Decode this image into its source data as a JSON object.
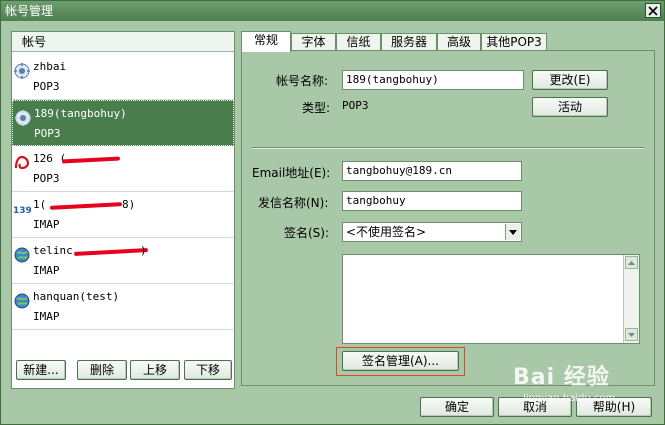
{
  "window": {
    "title": "帐号管理"
  },
  "accounts": {
    "header": "帐号",
    "items": [
      {
        "name": "zhbai",
        "type": "POP3",
        "icon": "gear-globe-icon"
      },
      {
        "name": "189(tangbohuy)",
        "type": "POP3",
        "icon": "gear-globe-icon"
      },
      {
        "name": "126 (",
        "type": "POP3",
        "icon": "mail-126-icon"
      },
      {
        "name": "1(",
        "type": "IMAP",
        "icon": "mail-139-icon",
        "name_suffix": "8)"
      },
      {
        "name": "telinc",
        "type": "IMAP",
        "icon": "globe-icon",
        "name_suffix": ")"
      },
      {
        "name": "hanquan(test)",
        "type": "IMAP",
        "icon": "globe-icon"
      }
    ],
    "buttons": {
      "new": "新建...",
      "delete": "删除",
      "up": "上移",
      "down": "下移"
    }
  },
  "tabs": [
    "常规",
    "字体",
    "信纸",
    "服务器",
    "高级",
    "其他POP3"
  ],
  "general": {
    "account_name_label": "帐号名称:",
    "account_name_value": "189(tangbohuy)",
    "change_button": "更改(E)",
    "type_label": "类型:",
    "type_value": "POP3",
    "active_button": "活动",
    "email_label": "Email地址(E):",
    "email_value": "tangbohuy@189.cn",
    "sender_label": "发信名称(N):",
    "sender_value": "tangbohuy",
    "signature_label": "签名(S):",
    "signature_value": "<不使用签名>",
    "signature_manage_button": "签名管理(A)..."
  },
  "footer": {
    "ok": "确定",
    "cancel": "取消",
    "help": "帮助(H)"
  },
  "watermark": {
    "brand": "Bai 经验",
    "url": "jingyan.baidu.com"
  }
}
